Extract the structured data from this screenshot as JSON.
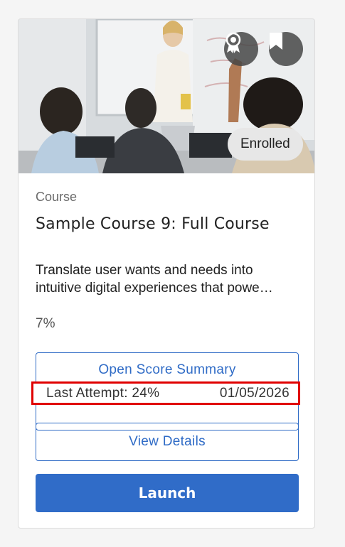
{
  "card": {
    "enrolled_badge": "Enrolled",
    "icons": {
      "award": "award-ribbon-icon",
      "bookmark": "bookmark-icon"
    },
    "type_label": "Course",
    "title": "Sample Course 9: Full Course",
    "description_line1": "Translate user wants and needs into",
    "description_line2": "intuitive digital experiences that powe…",
    "progress": "7%",
    "score": {
      "link_label": "Open Score Summary",
      "last_attempt": "Last Attempt: 24%",
      "date": "01/05/2026"
    },
    "view_details_label": "View Details",
    "launch_label": "Launch"
  },
  "colors": {
    "accent": "#306cc8",
    "highlight_border": "#e00000",
    "icon_button_bg": "#464646"
  }
}
